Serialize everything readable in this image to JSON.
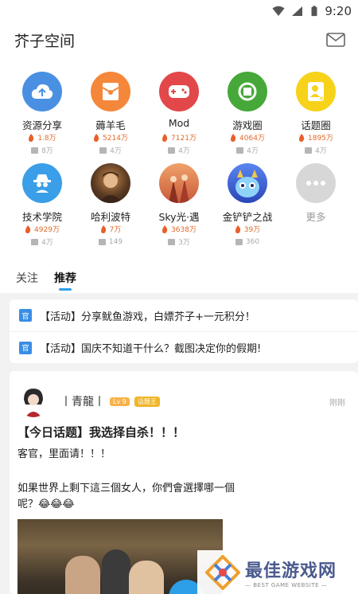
{
  "status_bar": {
    "time": "9:20"
  },
  "header": {
    "title": "芥子空间"
  },
  "categories": [
    {
      "name": "资源分享",
      "hot": "1.8万",
      "comments": "8万",
      "icon": "cloud-upload-icon",
      "color": "#4a90e2"
    },
    {
      "name": "薅羊毛",
      "hot": "5214万",
      "comments": "4万",
      "icon": "red-envelope-icon",
      "color": "#f5873a"
    },
    {
      "name": "Mod",
      "hot": "7121万",
      "comments": "4万",
      "icon": "gamepad-icon",
      "color": "#e2484a"
    },
    {
      "name": "游戏圈",
      "hot": "4064万",
      "comments": "4万",
      "icon": "camera-shutter-icon",
      "color": "#47a83a"
    },
    {
      "name": "话题圈",
      "hot": "1895万",
      "comments": "4万",
      "icon": "user-topic-icon",
      "color": "#f7d21a"
    },
    {
      "name": "技术学院",
      "hot": "4929万",
      "comments": "4万",
      "icon": "spy-icon",
      "color": "#3a9ee8"
    },
    {
      "name": "哈利波特",
      "hot": "7万",
      "comments": "149",
      "icon": "harry-potter-image",
      "color": "#3a2d24"
    },
    {
      "name": "Sky光·遇",
      "hot": "3638万",
      "comments": "3万",
      "icon": "sky-game-image",
      "color": "#d0703e"
    },
    {
      "name": "金铲铲之战",
      "hot": "39万",
      "comments": "360",
      "icon": "tft-game-image",
      "color": "#3a66d8"
    },
    {
      "name": "更多",
      "icon": "more-icon",
      "color": "#d7d7d7"
    }
  ],
  "tabs": {
    "follow": "关注",
    "recommend": "推荐"
  },
  "notices": [
    {
      "tag": "官",
      "text": "【活动】分享鱿鱼游戏，白嫖芥子+一元积分！"
    },
    {
      "tag": "官",
      "text": "【活动】国庆不知道干什么？截图决定你的假期!"
    }
  ],
  "post": {
    "username": "丨青龍丨",
    "level": "Lv 9",
    "role": "话题王",
    "time": "刚刚",
    "title": "【今日话题】我选择自杀！！！",
    "subtitle": "客官，里面请！！！",
    "body": "如果世界上剩下這三個女人，你們會選擇哪一個呢？😂😂😂"
  },
  "watermark": {
    "main": "最佳游戏网",
    "sub": "— BEST GAME WEBSITE —"
  }
}
